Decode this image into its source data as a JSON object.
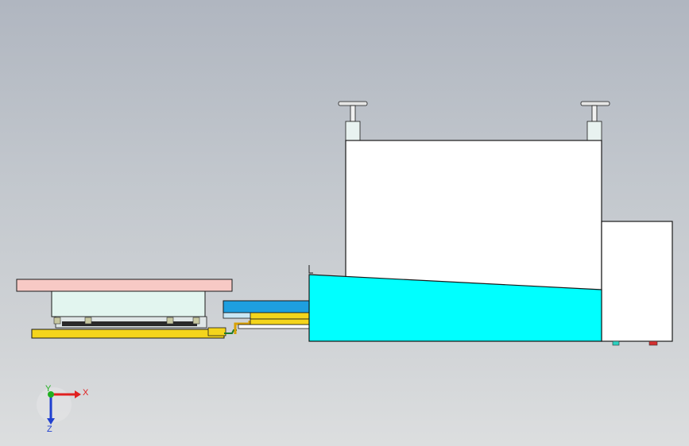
{
  "scene": {
    "colors": {
      "background_top": "#b0b6c0",
      "background_bottom": "#dcdedf",
      "left_top_plate": "#f7c9c5",
      "left_block": "#e2f5ef",
      "yellow_parts": "#f4d51c",
      "blue_rail": "#1e9fe0",
      "cyan_wedge": "#00ffff",
      "white_housing": "#ffffff",
      "outline": "#1a1a1a"
    }
  },
  "triad": {
    "x_label": "X",
    "y_label": "Y",
    "z_label": "Z",
    "x_color": "#e02020",
    "y_color": "#20b020",
    "z_color": "#2040d0"
  }
}
